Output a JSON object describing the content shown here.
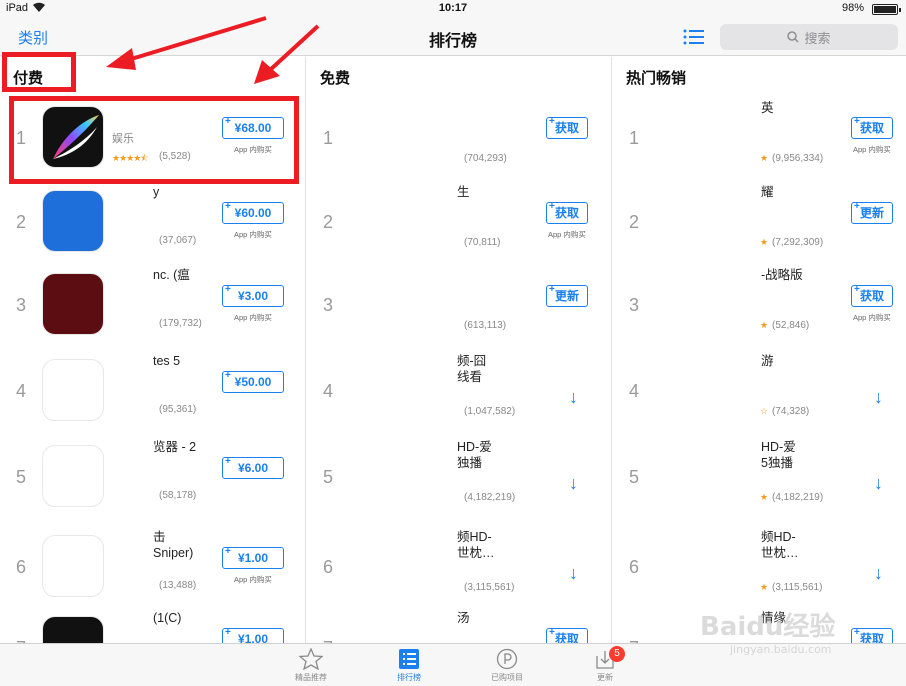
{
  "status_bar": {
    "device": "iPad",
    "time": "10:17",
    "battery": "98%",
    "battery_level": 0.98
  },
  "nav": {
    "back_label": "类别",
    "title": "排行榜",
    "search_placeholder": "搜索"
  },
  "columns": [
    {
      "header": "付费",
      "rows": [
        {
          "rank": "1",
          "name": "",
          "category": "娱乐",
          "stars": "★★★★⯪",
          "reviews": "(5,528)",
          "button": "¥68.00",
          "iap": "App 内购买"
        },
        {
          "rank": "2",
          "name": "y",
          "reviews": "(37,067)",
          "button": "¥60.00",
          "iap": "App 内购买"
        },
        {
          "rank": "3",
          "name": "nc. (瘟",
          "reviews": "(179,732)",
          "button": "¥3.00",
          "iap": "App 内购买"
        },
        {
          "rank": "4",
          "name": "tes 5",
          "reviews": "(95,361)",
          "button": "¥50.00"
        },
        {
          "rank": "5",
          "name": "览器 - 2",
          "reviews": "(58,178)",
          "button": "¥6.00"
        },
        {
          "rank": "6",
          "name": "击\nSniper)",
          "reviews": "(13,488)",
          "button": "¥1.00",
          "iap": "App 内购买"
        },
        {
          "rank": "7",
          "name": "(1(C)",
          "button": "¥1.00"
        }
      ]
    },
    {
      "header": "免费",
      "rows": [
        {
          "rank": "1",
          "name": "",
          "reviews": "(704,293)",
          "button": "获取"
        },
        {
          "rank": "2",
          "name": "生",
          "reviews": "(70,811)",
          "button": "获取",
          "iap": "App 内购买"
        },
        {
          "rank": "3",
          "name": "",
          "reviews": "(613,113)",
          "button": "更新"
        },
        {
          "rank": "4",
          "name": "频-囧\n线看",
          "reviews": "(1,047,582)",
          "button": "↓"
        },
        {
          "rank": "5",
          "name": "HD-爱\n独播",
          "reviews": "(4,182,219)",
          "button": "↓"
        },
        {
          "rank": "6",
          "name": "频HD-\n世枕…",
          "reviews": "(3,115,561)",
          "button": "↓"
        },
        {
          "rank": "7",
          "name": "汤",
          "button": "获取"
        }
      ]
    },
    {
      "header": "热门畅销",
      "rows": [
        {
          "rank": "1",
          "name": "英",
          "stars": "★",
          "reviews": "(9,956,334)",
          "button": "获取",
          "iap": "App 内购买"
        },
        {
          "rank": "2",
          "name": "耀",
          "stars": "★",
          "reviews": "(7,292,309)",
          "button": "更新"
        },
        {
          "rank": "3",
          "name": "-战略版",
          "stars": "★",
          "reviews": "(52,846)",
          "button": "获取",
          "iap": "App 内购买"
        },
        {
          "rank": "4",
          "name": "游",
          "stars": "☆",
          "reviews": "(74,328)",
          "button": "↓"
        },
        {
          "rank": "5",
          "name": "HD-爱\n5独播",
          "stars": "★",
          "reviews": "(4,182,219)",
          "button": "↓"
        },
        {
          "rank": "6",
          "name": "频HD-\n世枕…",
          "stars": "★",
          "reviews": "(3,115,561)",
          "button": "↓"
        },
        {
          "rank": "7",
          "name": "情缘",
          "button": "获取"
        }
      ]
    }
  ],
  "tabs": [
    {
      "label": "精品推荐",
      "icon": "star-icon",
      "active": false
    },
    {
      "label": "排行榜",
      "icon": "list-icon",
      "active": true
    },
    {
      "label": "已购项目",
      "icon": "purchased-icon",
      "active": false
    },
    {
      "label": "更新",
      "icon": "update-icon",
      "active": false,
      "badge": "5"
    }
  ],
  "watermark": {
    "brand": "Baidu经验",
    "url": "jingyan.baidu.com"
  },
  "colors": {
    "accent": "#1a80f0",
    "annotation": "#ec1c24",
    "badge": "#ff3b30"
  }
}
